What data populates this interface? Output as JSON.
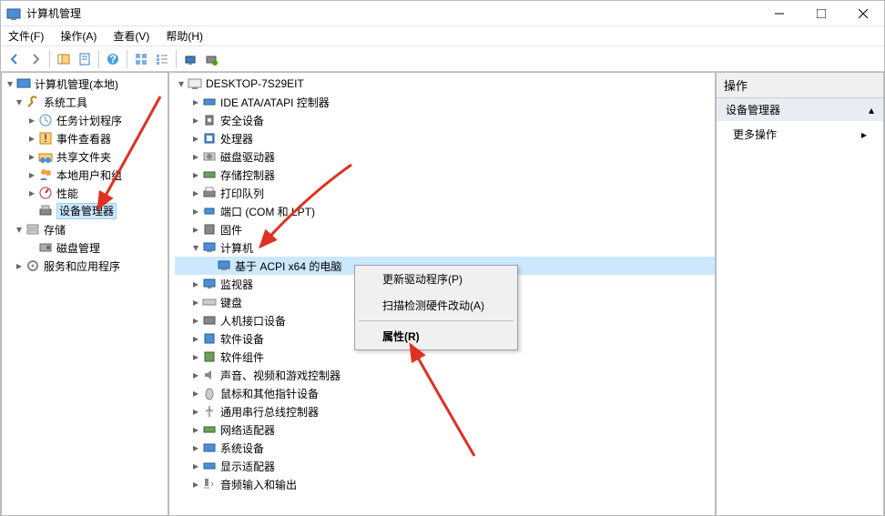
{
  "title": "计算机管理",
  "menu": {
    "file": "文件(F)",
    "action": "操作(A)",
    "view": "查看(V)",
    "help": "帮助(H)"
  },
  "left_tree": {
    "root": "计算机管理(本地)",
    "system_tools": "系统工具",
    "task_scheduler": "任务计划程序",
    "event_viewer": "事件查看器",
    "shared_folders": "共享文件夹",
    "local_users": "本地用户和组",
    "performance": "性能",
    "device_manager": "设备管理器",
    "storage": "存储",
    "disk_mgmt": "磁盘管理",
    "services_apps": "服务和应用程序"
  },
  "mid_tree": {
    "root": "DESKTOP-7S29EIT",
    "ide": "IDE ATA/ATAPI 控制器",
    "security": "安全设备",
    "cpu": "处理器",
    "disk_drives": "磁盘驱动器",
    "storage_ctrl": "存储控制器",
    "print_queue": "打印队列",
    "ports": "端口 (COM 和 LPT)",
    "firmware": "固件",
    "computer": "计算机",
    "computer_child": "基于 ACPI x64 的电脑",
    "monitor": "监视器",
    "keyboard": "键盘",
    "hid": "人机接口设备",
    "software_dev": "软件设备",
    "software_comp": "软件组件",
    "sound": "声音、视频和游戏控制器",
    "mouse": "鼠标和其他指针设备",
    "usb": "通用串行总线控制器",
    "network": "网络适配器",
    "system_dev": "系统设备",
    "display": "显示适配器",
    "audio_io": "音频输入和输出"
  },
  "ctx": {
    "update": "更新驱动程序(P)",
    "scan": "扫描检测硬件改动(A)",
    "properties": "属性(R)"
  },
  "right": {
    "head": "操作",
    "sub": "设备管理器",
    "more": "更多操作"
  }
}
